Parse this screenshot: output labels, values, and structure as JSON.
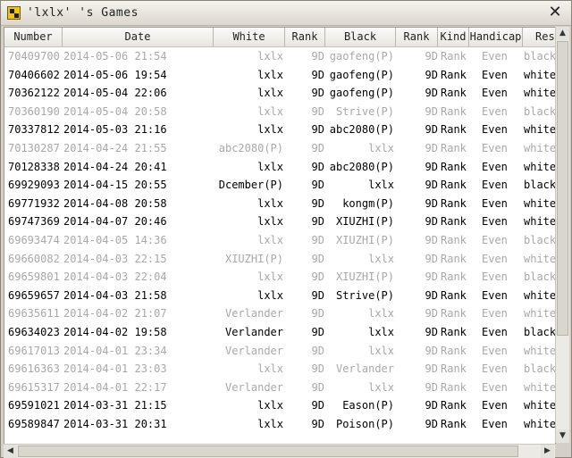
{
  "window": {
    "title": "'lxlx' 's Games"
  },
  "columns": [
    "Number",
    "Date",
    "White",
    "Rank",
    "Black",
    "Rank",
    "Kind",
    "Handicap",
    "Result"
  ],
  "rows": [
    {
      "number": "70409700",
      "date": "2014-05-06 21:54",
      "white": "lxlx",
      "wrank": "9D",
      "black": "gaofeng(P)",
      "brank": "9D",
      "kind": "Rank",
      "handicap": "Even",
      "result": "black",
      "active": false
    },
    {
      "number": "70406602",
      "date": "2014-05-06 19:54",
      "white": "lxlx",
      "wrank": "9D",
      "black": "gaofeng(P)",
      "brank": "9D",
      "kind": "Rank",
      "handicap": "Even",
      "result": "white",
      "active": true
    },
    {
      "number": "70362122",
      "date": "2014-05-04 22:06",
      "white": "lxlx",
      "wrank": "9D",
      "black": "gaofeng(P)",
      "brank": "9D",
      "kind": "Rank",
      "handicap": "Even",
      "result": "white",
      "active": true
    },
    {
      "number": "70360190",
      "date": "2014-05-04 20:58",
      "white": "lxlx",
      "wrank": "9D",
      "black": "Strive(P)",
      "brank": "9D",
      "kind": "Rank",
      "handicap": "Even",
      "result": "black",
      "active": false
    },
    {
      "number": "70337812",
      "date": "2014-05-03 21:16",
      "white": "lxlx",
      "wrank": "9D",
      "black": "abc2080(P)",
      "brank": "9D",
      "kind": "Rank",
      "handicap": "Even",
      "result": "white",
      "active": true
    },
    {
      "number": "70130287",
      "date": "2014-04-24 21:55",
      "white": "abc2080(P)",
      "wrank": "9D",
      "black": "lxlx",
      "brank": "9D",
      "kind": "Rank",
      "handicap": "Even",
      "result": "white",
      "active": false
    },
    {
      "number": "70128338",
      "date": "2014-04-24 20:41",
      "white": "lxlx",
      "wrank": "9D",
      "black": "abc2080(P)",
      "brank": "9D",
      "kind": "Rank",
      "handicap": "Even",
      "result": "white",
      "active": true
    },
    {
      "number": "69929093",
      "date": "2014-04-15 20:55",
      "white": "Dcember(P)",
      "wrank": "9D",
      "black": "lxlx",
      "brank": "9D",
      "kind": "Rank",
      "handicap": "Even",
      "result": "black",
      "active": true
    },
    {
      "number": "69771932",
      "date": "2014-04-08 20:58",
      "white": "lxlx",
      "wrank": "9D",
      "black": "kongm(P)",
      "brank": "9D",
      "kind": "Rank",
      "handicap": "Even",
      "result": "white",
      "active": true
    },
    {
      "number": "69747369",
      "date": "2014-04-07 20:46",
      "white": "lxlx",
      "wrank": "9D",
      "black": "XIUZHI(P)",
      "brank": "9D",
      "kind": "Rank",
      "handicap": "Even",
      "result": "white",
      "active": true
    },
    {
      "number": "69693474",
      "date": "2014-04-05 14:36",
      "white": "lxlx",
      "wrank": "9D",
      "black": "XIUZHI(P)",
      "brank": "9D",
      "kind": "Rank",
      "handicap": "Even",
      "result": "black",
      "active": false
    },
    {
      "number": "69660082",
      "date": "2014-04-03 22:15",
      "white": "XIUZHI(P)",
      "wrank": "9D",
      "black": "lxlx",
      "brank": "9D",
      "kind": "Rank",
      "handicap": "Even",
      "result": "white",
      "active": false
    },
    {
      "number": "69659801",
      "date": "2014-04-03 22:04",
      "white": "lxlx",
      "wrank": "9D",
      "black": "XIUZHI(P)",
      "brank": "9D",
      "kind": "Rank",
      "handicap": "Even",
      "result": "black",
      "active": false
    },
    {
      "number": "69659657",
      "date": "2014-04-03 21:58",
      "white": "lxlx",
      "wrank": "9D",
      "black": "Strive(P)",
      "brank": "9D",
      "kind": "Rank",
      "handicap": "Even",
      "result": "white",
      "active": true
    },
    {
      "number": "69635611",
      "date": "2014-04-02 21:07",
      "white": "Verlander",
      "wrank": "9D",
      "black": "lxlx",
      "brank": "9D",
      "kind": "Rank",
      "handicap": "Even",
      "result": "white",
      "active": false
    },
    {
      "number": "69634023",
      "date": "2014-04-02 19:58",
      "white": "Verlander",
      "wrank": "9D",
      "black": "lxlx",
      "brank": "9D",
      "kind": "Rank",
      "handicap": "Even",
      "result": "black",
      "active": true
    },
    {
      "number": "69617013",
      "date": "2014-04-01 23:34",
      "white": "Verlander",
      "wrank": "9D",
      "black": "lxlx",
      "brank": "9D",
      "kind": "Rank",
      "handicap": "Even",
      "result": "white",
      "active": false
    },
    {
      "number": "69616363",
      "date": "2014-04-01 23:03",
      "white": "lxlx",
      "wrank": "9D",
      "black": "Verlander",
      "brank": "9D",
      "kind": "Rank",
      "handicap": "Even",
      "result": "black",
      "active": false
    },
    {
      "number": "69615317",
      "date": "2014-04-01 22:17",
      "white": "Verlander",
      "wrank": "9D",
      "black": "lxlx",
      "brank": "9D",
      "kind": "Rank",
      "handicap": "Even",
      "result": "white",
      "active": false
    },
    {
      "number": "69591021",
      "date": "2014-03-31 21:15",
      "white": "lxlx",
      "wrank": "9D",
      "black": "Eason(P)",
      "brank": "9D",
      "kind": "Rank",
      "handicap": "Even",
      "result": "white",
      "active": true
    },
    {
      "number": "69589847",
      "date": "2014-03-31 20:31",
      "white": "lxlx",
      "wrank": "9D",
      "black": "Poison(P)",
      "brank": "9D",
      "kind": "Rank",
      "handicap": "Even",
      "result": "white",
      "active": true
    }
  ]
}
